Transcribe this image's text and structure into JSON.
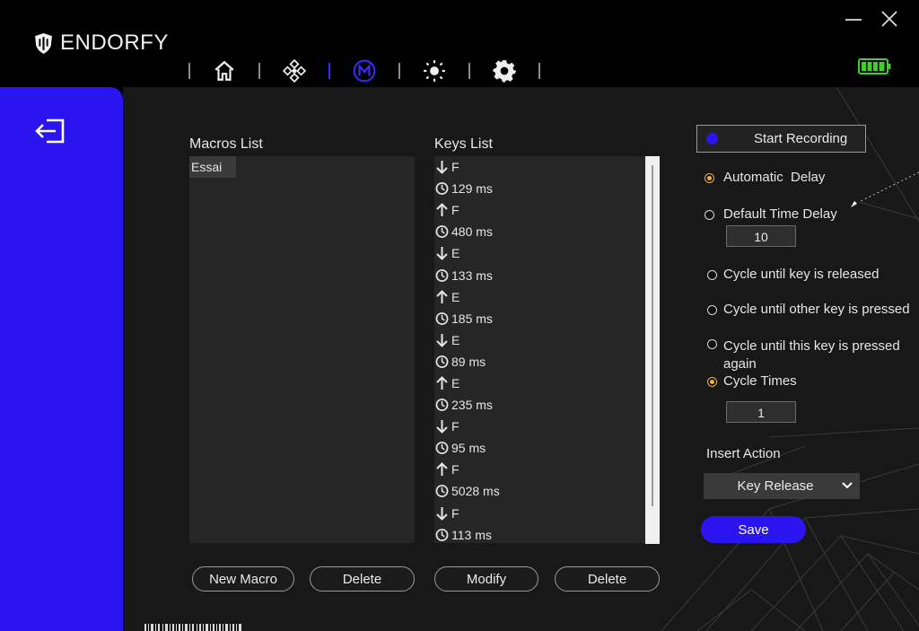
{
  "app": {
    "brand": "ENDORFY",
    "battery_level": 1.0
  },
  "nav": {
    "items": [
      {
        "icon": "home-icon"
      },
      {
        "icon": "dpad-icon"
      },
      {
        "icon": "macro-icon",
        "active": true
      },
      {
        "icon": "lighting-icon"
      },
      {
        "icon": "gear-icon"
      }
    ]
  },
  "sidebar": {
    "back_icon": "exit-icon"
  },
  "macros": {
    "title": "Macros List",
    "items": [
      "Essai"
    ],
    "new_label": "New Macro",
    "delete_label": "Delete"
  },
  "keys": {
    "title": "Keys List",
    "rows": [
      {
        "icon": "arrow-down-icon",
        "text": "F"
      },
      {
        "icon": "clock-icon",
        "text": "129 ms"
      },
      {
        "icon": "arrow-up-icon",
        "text": "F"
      },
      {
        "icon": "clock-icon",
        "text": "480 ms"
      },
      {
        "icon": "arrow-down-icon",
        "text": "E"
      },
      {
        "icon": "clock-icon",
        "text": "133 ms"
      },
      {
        "icon": "arrow-up-icon",
        "text": "E"
      },
      {
        "icon": "clock-icon",
        "text": "185 ms"
      },
      {
        "icon": "arrow-down-icon",
        "text": "E"
      },
      {
        "icon": "clock-icon",
        "text": "89 ms"
      },
      {
        "icon": "arrow-up-icon",
        "text": "E"
      },
      {
        "icon": "clock-icon",
        "text": "235 ms"
      },
      {
        "icon": "arrow-down-icon",
        "text": "F"
      },
      {
        "icon": "clock-icon",
        "text": "95 ms"
      },
      {
        "icon": "arrow-up-icon",
        "text": "F"
      },
      {
        "icon": "clock-icon",
        "text": "5028 ms"
      },
      {
        "icon": "arrow-down-icon",
        "text": "F"
      },
      {
        "icon": "clock-icon",
        "text": "113 ms"
      }
    ],
    "modify_label": "Modify",
    "delete_label": "Delete"
  },
  "recording": {
    "start_label": "Start Recording",
    "automatic_delay": "Automatic  Delay",
    "default_time_delay": "Default Time Delay",
    "default_delay_value": "10",
    "cycle_released": "Cycle until key is released",
    "cycle_other": "Cycle until other key is pressed",
    "cycle_this_line1": "Cycle until this key is pressed",
    "cycle_this_line2": "again",
    "cycle_times": "Cycle Times",
    "cycle_times_value": "1",
    "insert_action_label": "Insert Action",
    "insert_action_value": "Key Release",
    "save_label": "Save"
  },
  "colors": {
    "accent": "#2a14f0",
    "radio_selected": "#f0b030",
    "background": "#181818"
  }
}
